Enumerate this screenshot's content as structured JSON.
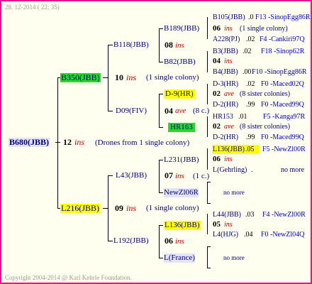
{
  "header": {
    "date": "28. 12-2014 ( 22: 35)"
  },
  "footer": {
    "copyright": "Copyright 2004-2014 @ Karl Kehrle Foundation."
  },
  "root": {
    "id": "B680(JBB)",
    "count": "12",
    "unit": "ins",
    "note": "(Drones from 1 single colony)"
  },
  "gen1": {
    "top": {
      "id": "B350(JBB)",
      "count": "10",
      "unit": "ins",
      "note": "(1 single colony)"
    },
    "bottom": {
      "id": "L216(JBB)",
      "count": "09",
      "unit": "ins",
      "note": "(1 single colony)"
    }
  },
  "gen2": {
    "a": {
      "id": "B118(JBB)",
      "count": "08",
      "unit": "ins"
    },
    "b": {
      "id": "D09(FIV)",
      "count": "04",
      "unit": "ave",
      "note": "(8 c.)"
    },
    "c": {
      "id": "L43(JBB)",
      "count": "07",
      "unit": "ins",
      "note": "(1 c.)"
    },
    "d": {
      "id": "L192(JBB)",
      "count": "06",
      "unit": "ins"
    }
  },
  "gen3": {
    "a1": "B189(JBB)",
    "a2": "B82(JBB)",
    "b1": "D-9(HR)",
    "b2": "HR163",
    "c1": "L231(JBB)",
    "c2": "NewZl06R",
    "d1": "L136(JBB)",
    "d2": "L(France)"
  },
  "gen4": {
    "a1": {
      "line1": {
        "id": "B105(JBB)",
        "val": ".0",
        "loc": "F13 -SinopEgg86R"
      },
      "count": "06",
      "unit": "ins",
      "note": "(1 single colony)",
      "line2": {
        "id": "A228(PJ)",
        "val": ".02",
        "loc": "F4 -Cankiri97Q"
      }
    },
    "a2": {
      "line1": {
        "id": "B3(JBB)",
        "val": ".02",
        "loc": "F18 -Sinop62R"
      },
      "count": "04",
      "unit": "ins",
      "line2": {
        "id": "B4(JBB)",
        "val": ".00",
        "loc": "F10 -SinopEgg86R"
      }
    },
    "b1": {
      "line1": {
        "id": "D-3(HR)",
        "val": ".02",
        "loc": "F0 -Maced02Q"
      },
      "count": "02",
      "unit": "ave",
      "note": "(8 sister colonies)",
      "line2": {
        "id": "D-2(HR)",
        "val": ".99",
        "loc": "F0 -Maced99Q"
      }
    },
    "b2": {
      "line1": {
        "id": "HR153",
        "val": ".01",
        "loc": "F5 -Kanga97R"
      },
      "count": "02",
      "unit": "ave",
      "note": "(8 sister colonies)",
      "line2": {
        "id": "D-2(HR)",
        "val": ".99",
        "loc": "F0 -Maced99Q"
      }
    },
    "c1": {
      "line1": {
        "id": "L136(JBB)",
        "val": ".05",
        "loc": "F5 -NewZl00R"
      },
      "count": "06",
      "unit": "ins",
      "line2": {
        "id": "L(Gehrling)",
        "val": ".",
        "loc": "no more"
      }
    },
    "c2": {
      "more": "no more"
    },
    "d1": {
      "line1": {
        "id": "L44(JBB)",
        "val": ".03",
        "loc": "F4 -NewZl00R"
      },
      "count": "05",
      "unit": "ins",
      "line2": {
        "id": "L4(HJG)",
        "val": ".04",
        "loc": "F0 -NewZl04Q"
      }
    },
    "d2": {
      "more": "no more"
    }
  }
}
